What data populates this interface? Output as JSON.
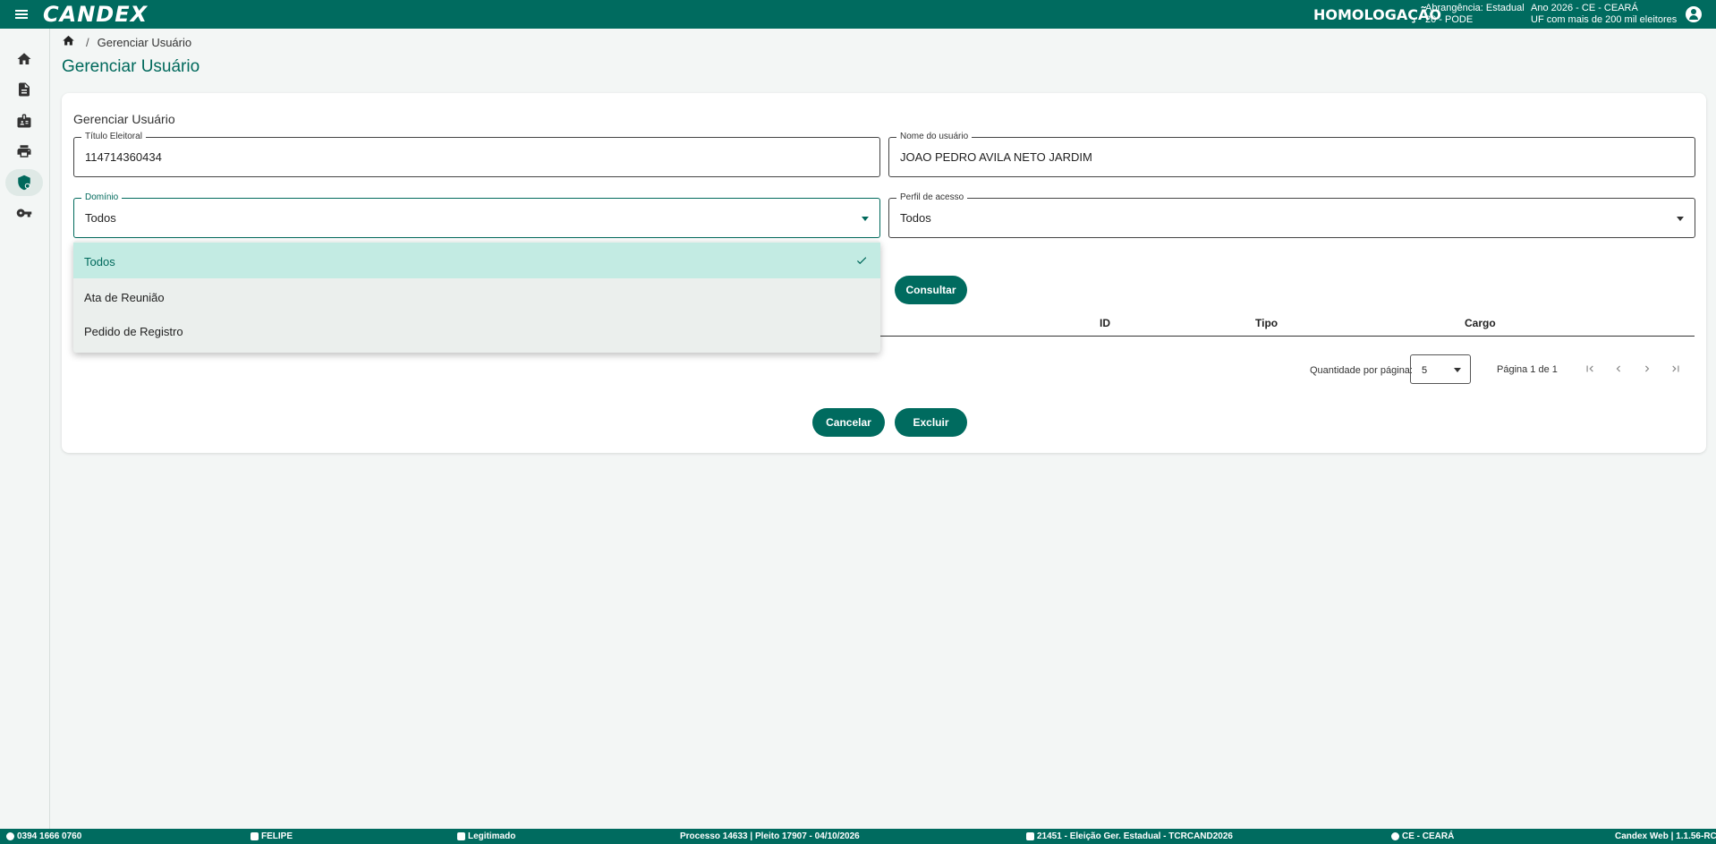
{
  "header": {
    "logo": "CANDEX",
    "environment": "HOMOLOGAÇÃO",
    "scope_line1": "Abrangência: Estadual",
    "scope_line2": "20 - PODE",
    "year_line1": "Ano 2026 - CE - CEARÁ",
    "year_line2": "UF com mais de 200 mil eleitores"
  },
  "sidebar": {
    "items": [
      {
        "icon": "home-icon"
      },
      {
        "icon": "document-icon"
      },
      {
        "icon": "badge-icon"
      },
      {
        "icon": "print-icon"
      },
      {
        "icon": "admin-shield-icon",
        "active": true
      },
      {
        "icon": "key-icon"
      }
    ]
  },
  "breadcrumb": {
    "current": "Gerenciar Usuário"
  },
  "page": {
    "title": "Gerenciar Usuário"
  },
  "form": {
    "section_title": "Gerenciar Usuário",
    "titulo": {
      "label": "Título Eleitoral",
      "value": "114714360434"
    },
    "nome": {
      "label": "Nome do usuário",
      "value": "JOAO PEDRO AVILA NETO JARDIM"
    },
    "dominio": {
      "label": "Domínio",
      "value": "Todos"
    },
    "perfil": {
      "label": "Perfil de acesso",
      "value": "Todos"
    },
    "consultar_label": "Consultar"
  },
  "dropdown": {
    "options": [
      "Todos",
      "Ata de Reunião",
      "Pedido de Registro"
    ],
    "selected": "Todos"
  },
  "table": {
    "columns": [
      "ID",
      "Tipo",
      "Cargo"
    ]
  },
  "pager": {
    "page_size_label": "Quantidade por página:",
    "page_size": "5",
    "page_info": "Página 1 de 1"
  },
  "actions": {
    "cancel": "Cancelar",
    "delete": "Excluir"
  },
  "footer": {
    "phone": "0394 1666 0760",
    "user": "FELIPE",
    "status": "Legitimado",
    "process": "Processo 14633 | Pleito 17907 - 04/10/2026",
    "election": "21451 - Eleição Ger. Estadual - TCRCAND2026",
    "uf": "CE - CEARÁ",
    "version": "Candex Web | 1.1.56-RC"
  },
  "colors": {
    "primary": "#006b5f",
    "selected_option": "#c3ebe3"
  }
}
